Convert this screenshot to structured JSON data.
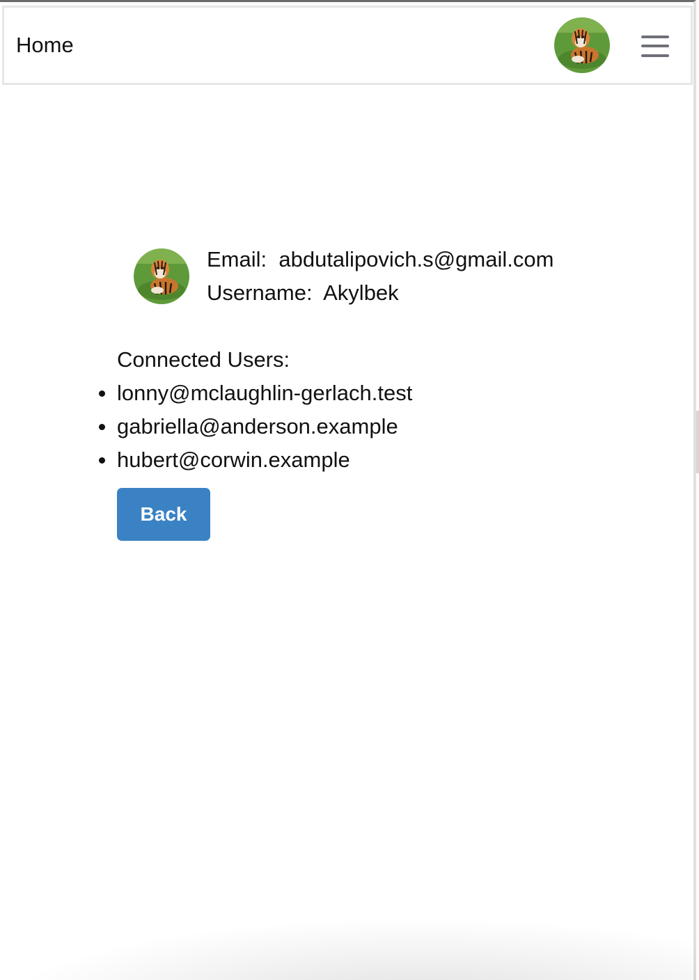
{
  "navbar": {
    "home_label": "Home",
    "avatar_icon": "tiger-avatar-icon",
    "menu_icon": "hamburger-menu-icon"
  },
  "profile": {
    "email_line": "Email:  abdutalipovich.s@gmail.com",
    "username_line": "Username:  Akylbek",
    "avatar_icon": "tiger-avatar-icon"
  },
  "connected": {
    "title": "Connected Users:",
    "users": [
      "lonny@mclaughlin-gerlach.test",
      "gabriella@anderson.example",
      "hubert@corwin.example"
    ]
  },
  "actions": {
    "back_label": "Back"
  },
  "colors": {
    "accent": "#3a82c4",
    "menu_icon": "#6e7079"
  }
}
